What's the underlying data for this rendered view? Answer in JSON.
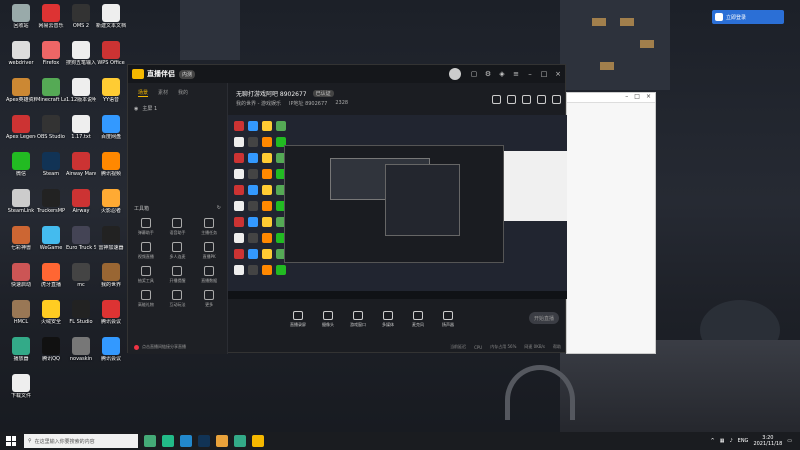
{
  "desktop_icons": [
    {
      "label": "回收站",
      "color": "#9aa"
    },
    {
      "label": "网易云音乐",
      "color": "#d33"
    },
    {
      "label": "OMS 2",
      "color": "#333"
    },
    {
      "label": "新建文本文档",
      "color": "#eee"
    },
    {
      "label": "webdriver",
      "color": "#ddd"
    },
    {
      "label": "Firefox",
      "color": "#e66"
    },
    {
      "label": "搜狗五笔输入法",
      "color": "#eee"
    },
    {
      "label": "WPS Office",
      "color": "#c33"
    },
    {
      "label": "Apex英雄资料站",
      "color": "#c83"
    },
    {
      "label": "Minecraft Launcher",
      "color": "#5a5"
    },
    {
      "label": "1.12版本说明.txt",
      "color": "#eee"
    },
    {
      "label": "YY语音",
      "color": "#fc3"
    },
    {
      "label": "Apex Legends",
      "color": "#c33"
    },
    {
      "label": "OBS Studio",
      "color": "#333"
    },
    {
      "label": "1.17.txt",
      "color": "#eee"
    },
    {
      "label": "百度网盘",
      "color": "#39f"
    },
    {
      "label": "微信",
      "color": "#2b2"
    },
    {
      "label": "Steam",
      "color": "#135"
    },
    {
      "label": "Airway Manual",
      "color": "#c33"
    },
    {
      "label": "腾讯视频",
      "color": "#f80"
    },
    {
      "label": "SteamLink",
      "color": "#ccc"
    },
    {
      "label": "TruckersMP",
      "color": "#222"
    },
    {
      "label": "Airway",
      "color": "#c33"
    },
    {
      "label": "火影忍者",
      "color": "#fa3"
    },
    {
      "label": "七彩神兽",
      "color": "#c63"
    },
    {
      "label": "WeGame",
      "color": "#4be"
    },
    {
      "label": "Euro Truck Simulator 2",
      "color": "#445"
    },
    {
      "label": "雷神加速器",
      "color": "#222"
    },
    {
      "label": "快速启动",
      "color": "#c55"
    },
    {
      "label": "虎牙直播",
      "color": "#f63"
    },
    {
      "label": "mc",
      "color": "#444"
    },
    {
      "label": "我的世界",
      "color": "#963"
    },
    {
      "label": "HMCL",
      "color": "#975"
    },
    {
      "label": "火绒安全",
      "color": "#fc2"
    },
    {
      "label": "FL Studio",
      "color": "#222"
    },
    {
      "label": "腾讯会议",
      "color": "#d33"
    },
    {
      "label": "播放器",
      "color": "#3a8"
    },
    {
      "label": "腾讯QQ",
      "color": "#111"
    },
    {
      "label": "novaskin",
      "color": "#777"
    },
    {
      "label": "腾讯会议",
      "color": "#39f"
    },
    {
      "label": "下载文件",
      "color": "#eee"
    }
  ],
  "top_right_button": "立即登录",
  "app": {
    "name": "直播伴侣",
    "beta": "内测",
    "tabs": [
      "场景",
      "素材",
      "我的"
    ],
    "scene_label": "主屏 1",
    "stream_title": "无聊打游戏阿吧 8902677",
    "stream_tag": "已认证",
    "stream_meta": [
      "我的世界 - 游戏娱乐",
      "IP地址 8902677",
      "2328"
    ],
    "tools_header": "工具箱",
    "tools": [
      "弹幕助手",
      "语音助手",
      "主播任务",
      "视频直播",
      "多人连麦",
      "直播PK",
      "抽奖工具",
      "开播提醒",
      "直播数据",
      "高能礼物",
      "互动玩法",
      "更多"
    ],
    "left_footer": "点击直播间链接分享直播",
    "controls": [
      "直播录屏",
      "摄像头",
      "游戏窗口",
      "多媒体",
      "麦克风",
      "扬声器"
    ],
    "go_live": "开始直播",
    "footer_items": [
      "当前延迟",
      "CPU",
      "内存占用 56%",
      "网速 0KB/s",
      "帮助"
    ]
  },
  "taskbar": {
    "search_placeholder": "在这里输入你要搜索的内容",
    "lang": "ENG",
    "time": "3:20",
    "date": "2021/11/18"
  }
}
